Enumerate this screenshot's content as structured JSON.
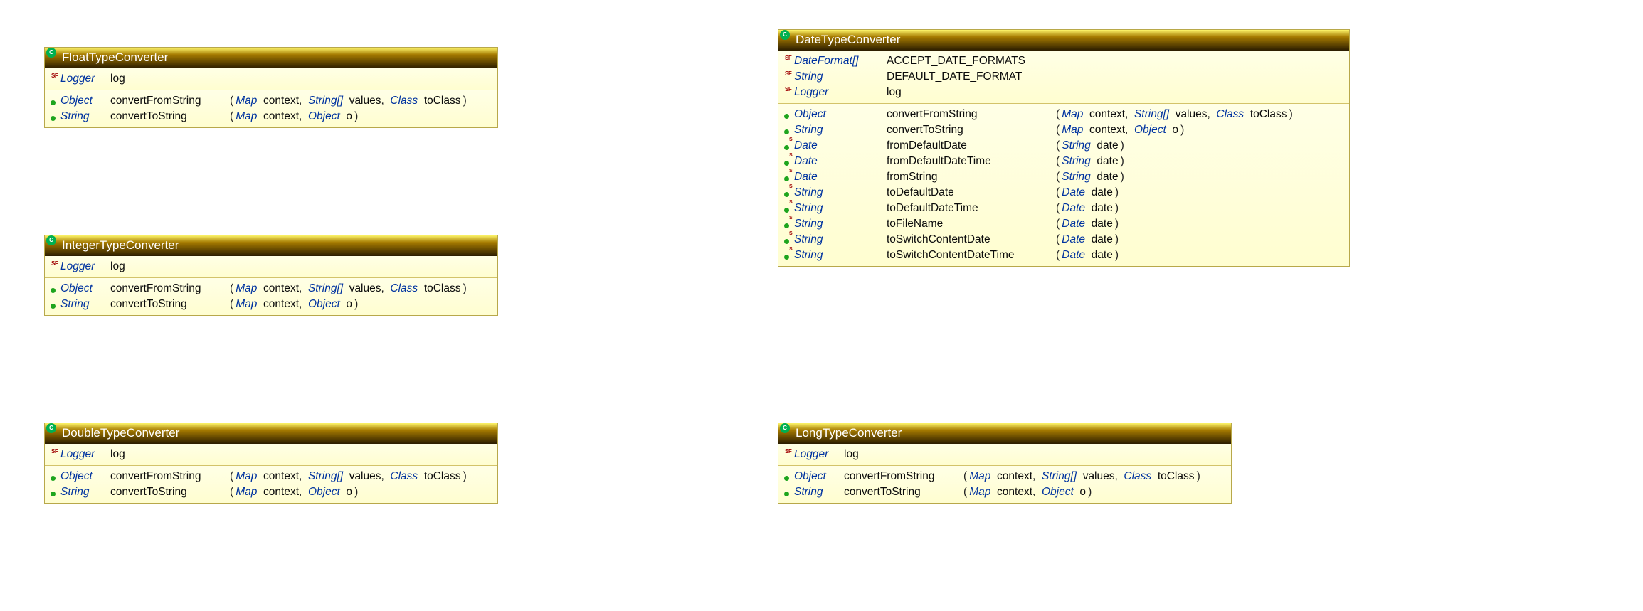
{
  "panels": {
    "float": {
      "title": "FloatTypeConverter",
      "fields": [
        {
          "ret": "Logger",
          "name": "log",
          "mods": "sf"
        }
      ],
      "methods": [
        {
          "ret": "Object",
          "name": "convertFromString",
          "params": [
            {
              "type": "Map",
              "name": "context"
            },
            {
              "type": "String[]",
              "name": "values"
            },
            {
              "type": "Class",
              "name": "toClass"
            }
          ]
        },
        {
          "ret": "String",
          "name": "convertToString",
          "params": [
            {
              "type": "Map",
              "name": "context"
            },
            {
              "type": "Object",
              "name": "o"
            }
          ]
        }
      ]
    },
    "integer": {
      "title": "IntegerTypeConverter",
      "fields": [
        {
          "ret": "Logger",
          "name": "log",
          "mods": "sf"
        }
      ],
      "methods": [
        {
          "ret": "Object",
          "name": "convertFromString",
          "params": [
            {
              "type": "Map",
              "name": "context"
            },
            {
              "type": "String[]",
              "name": "values"
            },
            {
              "type": "Class",
              "name": "toClass"
            }
          ]
        },
        {
          "ret": "String",
          "name": "convertToString",
          "params": [
            {
              "type": "Map",
              "name": "context"
            },
            {
              "type": "Object",
              "name": "o"
            }
          ]
        }
      ]
    },
    "double": {
      "title": "DoubleTypeConverter",
      "fields": [
        {
          "ret": "Logger",
          "name": "log",
          "mods": "sf"
        }
      ],
      "methods": [
        {
          "ret": "Object",
          "name": "convertFromString",
          "params": [
            {
              "type": "Map",
              "name": "context"
            },
            {
              "type": "String[]",
              "name": "values"
            },
            {
              "type": "Class",
              "name": "toClass"
            }
          ]
        },
        {
          "ret": "String",
          "name": "convertToString",
          "params": [
            {
              "type": "Map",
              "name": "context"
            },
            {
              "type": "Object",
              "name": "o"
            }
          ]
        }
      ]
    },
    "long": {
      "title": "LongTypeConverter",
      "fields": [
        {
          "ret": "Logger",
          "name": "log",
          "mods": "sf"
        }
      ],
      "methods": [
        {
          "ret": "Object",
          "name": "convertFromString",
          "params": [
            {
              "type": "Map",
              "name": "context"
            },
            {
              "type": "String[]",
              "name": "values"
            },
            {
              "type": "Class",
              "name": "toClass"
            }
          ]
        },
        {
          "ret": "String",
          "name": "convertToString",
          "params": [
            {
              "type": "Map",
              "name": "context"
            },
            {
              "type": "Object",
              "name": "o"
            }
          ]
        }
      ]
    },
    "date": {
      "title": "DateTypeConverter",
      "fields": [
        {
          "ret": "DateFormat[]",
          "name": "ACCEPT_DATE_FORMATS",
          "mods": "sf"
        },
        {
          "ret": "String",
          "name": "DEFAULT_DATE_FORMAT",
          "mods": "sf"
        },
        {
          "ret": "Logger",
          "name": "log",
          "mods": "sf"
        }
      ],
      "methods": [
        {
          "ret": "Object",
          "name": "convertFromString",
          "mods": "",
          "params": [
            {
              "type": "Map",
              "name": "context"
            },
            {
              "type": "String[]",
              "name": "values"
            },
            {
              "type": "Class",
              "name": "toClass"
            }
          ]
        },
        {
          "ret": "String",
          "name": "convertToString",
          "mods": "",
          "params": [
            {
              "type": "Map",
              "name": "context"
            },
            {
              "type": "Object",
              "name": "o"
            }
          ]
        },
        {
          "ret": "Date",
          "name": "fromDefaultDate",
          "mods": "s",
          "params": [
            {
              "type": "String",
              "name": "date"
            }
          ]
        },
        {
          "ret": "Date",
          "name": "fromDefaultDateTime",
          "mods": "s",
          "params": [
            {
              "type": "String",
              "name": "date"
            }
          ]
        },
        {
          "ret": "Date",
          "name": "fromString",
          "mods": "s",
          "params": [
            {
              "type": "String",
              "name": "date"
            }
          ]
        },
        {
          "ret": "String",
          "name": "toDefaultDate",
          "mods": "s",
          "params": [
            {
              "type": "Date",
              "name": "date"
            }
          ]
        },
        {
          "ret": "String",
          "name": "toDefaultDateTime",
          "mods": "s",
          "params": [
            {
              "type": "Date",
              "name": "date"
            }
          ]
        },
        {
          "ret": "String",
          "name": "toFileName",
          "mods": "s",
          "params": [
            {
              "type": "Date",
              "name": "date"
            }
          ]
        },
        {
          "ret": "String",
          "name": "toSwitchContentDate",
          "mods": "s",
          "params": [
            {
              "type": "Date",
              "name": "date"
            }
          ]
        },
        {
          "ret": "String",
          "name": "toSwitchContentDateTime",
          "mods": "s",
          "params": [
            {
              "type": "Date",
              "name": "date"
            }
          ]
        }
      ]
    }
  }
}
